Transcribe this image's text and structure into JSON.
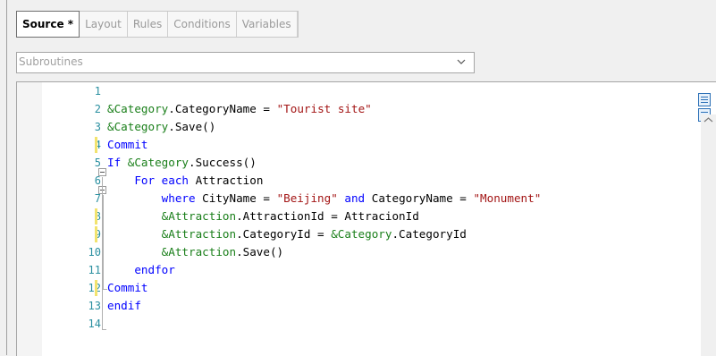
{
  "tabs": [
    {
      "label": "Source *",
      "active": true
    },
    {
      "label": "Layout",
      "active": false
    },
    {
      "label": "Rules",
      "active": false
    },
    {
      "label": "Conditions",
      "active": false
    },
    {
      "label": "Variables",
      "active": false
    }
  ],
  "dropdown": {
    "placeholder": "Subroutines",
    "icon": "chevron-down-icon"
  },
  "editor": {
    "line_numbers": [
      "1",
      "2",
      "3",
      "4",
      "5",
      "6",
      "7",
      "8",
      "9",
      "10",
      "11",
      "12",
      "13",
      "14"
    ],
    "lines": [
      [],
      [
        {
          "t": "&Category",
          "c": "var"
        },
        {
          "t": ".CategoryName = ",
          "c": ""
        },
        {
          "t": "\"Tourist site\"",
          "c": "str"
        }
      ],
      [
        {
          "t": "&Category",
          "c": "var"
        },
        {
          "t": ".Save()",
          "c": ""
        }
      ],
      [
        {
          "t": "Commit",
          "c": "kw"
        }
      ],
      [
        {
          "t": "If ",
          "c": "kw"
        },
        {
          "t": "&Category",
          "c": "var"
        },
        {
          "t": ".Success()",
          "c": ""
        }
      ],
      [
        {
          "t": "    For each ",
          "c": "kw"
        },
        {
          "t": "Attraction",
          "c": ""
        }
      ],
      [
        {
          "t": "        where ",
          "c": "kw"
        },
        {
          "t": "CityName = ",
          "c": ""
        },
        {
          "t": "\"Beijing\"",
          "c": "str"
        },
        {
          "t": " and ",
          "c": "kw"
        },
        {
          "t": "CategoryName = ",
          "c": ""
        },
        {
          "t": "\"Monument\"",
          "c": "str"
        }
      ],
      [
        {
          "t": "        &Attraction",
          "c": "var"
        },
        {
          "t": ".AttractionId = AttracionId",
          "c": ""
        }
      ],
      [
        {
          "t": "        &Attraction",
          "c": "var"
        },
        {
          "t": ".CategoryId = ",
          "c": ""
        },
        {
          "t": "&Category",
          "c": "var"
        },
        {
          "t": ".CategoryId",
          "c": ""
        }
      ],
      [
        {
          "t": "        &Attraction",
          "c": "var"
        },
        {
          "t": ".Save()",
          "c": ""
        }
      ],
      [
        {
          "t": "    endfor",
          "c": "kw"
        }
      ],
      [
        {
          "t": "Commit",
          "c": "kw"
        }
      ],
      [
        {
          "t": "endif",
          "c": "kw"
        }
      ],
      []
    ],
    "changed_lines": [
      4,
      8,
      9,
      12
    ],
    "colors": {
      "keyword": "#0000ff",
      "variable": "#1a7f1a",
      "string": "#a31515",
      "line_number": "#2a8fa0",
      "change_marker": "#f2e36e"
    }
  }
}
